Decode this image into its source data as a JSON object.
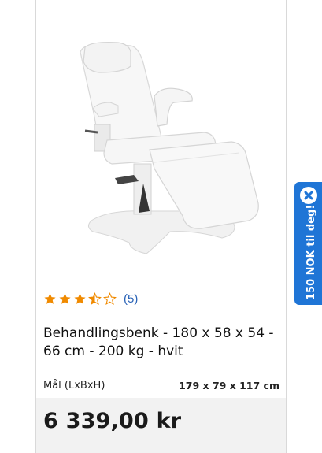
{
  "product": {
    "image_alt": "Behandlingsbenk",
    "rating": {
      "value": 3.5,
      "max": 5,
      "count_label": "(5)",
      "star_color": "#f08a00"
    },
    "title": "Behandlingsbenk - 180 x 58 x 54 - 66 cm - 200 kg - hvit",
    "dimensions": {
      "label": "Mål (LxBxH)",
      "value": "179 x 79 x 117 cm"
    },
    "price": "6 339,00 kr"
  },
  "promo": {
    "text": "150 NOK til deg!",
    "color": "#1f75d6",
    "close_icon": "close-icon"
  }
}
